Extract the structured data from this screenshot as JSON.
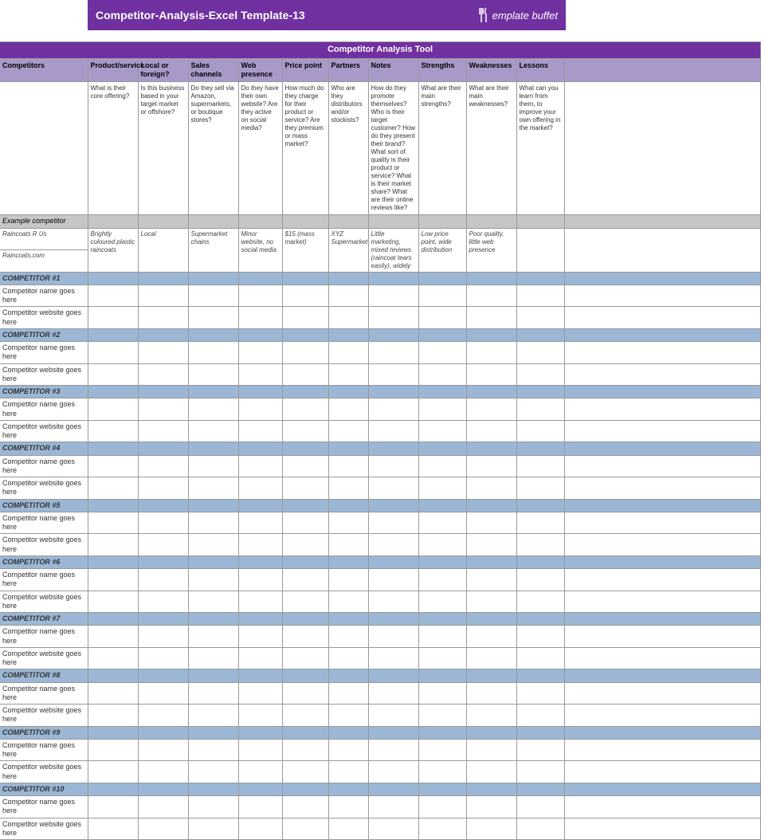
{
  "header": {
    "title": "Competitor-Analysis-Excel Template-13",
    "logo_text": "emplate buffet"
  },
  "table": {
    "title": "Competitor Analysis Tool",
    "columns": [
      "Competitors",
      "Product/service",
      "Local or foreign?",
      "Sales channels",
      "Web presence",
      "Price point",
      "Partners",
      "Notes",
      "Strengths",
      "Weaknesses",
      "Lessons"
    ],
    "desc": [
      "",
      "What is their core offering?",
      "Is this business based in your target market or offshore?",
      "Do they sell via Amazon, supermarkets, or boutique stores?",
      "Do they have their own website? Are they active on social media?",
      "How much do they charge for their product or service? Are they premium or mass market?",
      "Who are they distributors and/or stockists?",
      "How do they promote themselves? Who is their target customer? How do they present their brand? What sort of quality is their product or service? What is their market share? What are their online reviews like?",
      "What are their main strengths?",
      "What are their main weaknesses?",
      "What can you learn from them, to improve your own offering in the market?"
    ],
    "example": {
      "label": "Example competitor",
      "name": "Raincoats R Us",
      "website": "Raincoats.com",
      "data": [
        "Brightly coloured plastic raincoats",
        "Local",
        "Supermarket chains",
        "Minor website, no social media",
        "$15 (mass market)",
        "XYZ Supermarket",
        "Little marketing, mixed reviews (raincoat tears easily), widely",
        "Low price point, wide distribution",
        "Poor quality, little web presence",
        ""
      ]
    },
    "competitors": [
      {
        "head": "COMPETITOR #1",
        "name": "Competitor name goes here",
        "site": "Competitor website goes here"
      },
      {
        "head": "COMPETITOR #2",
        "name": "Competitor name goes here",
        "site": "Competitor website goes here"
      },
      {
        "head": "COMPETITOR #3",
        "name": "Competitor name goes here",
        "site": "Competitor website goes here"
      },
      {
        "head": "COMPETITOR #4",
        "name": "Competitor name goes here",
        "site": "Competitor website goes here"
      },
      {
        "head": "COMPETITOR #5",
        "name": "Competitor name goes here",
        "site": "Competitor website goes here"
      },
      {
        "head": "COMPETITOR #6",
        "name": "Competitor name goes here",
        "site": "Competitor website goes here"
      },
      {
        "head": "COMPETITOR #7",
        "name": "Competitor name goes here",
        "site": "Competitor website goes here"
      },
      {
        "head": "COMPETITOR #8",
        "name": "Competitor name goes here",
        "site": "Competitor website goes here"
      },
      {
        "head": "COMPETITOR #9",
        "name": "Competitor name goes here",
        "site": "Competitor website goes here"
      },
      {
        "head": "COMPETITOR #10",
        "name": "Competitor name goes here",
        "site": "Competitor website goes here"
      }
    ]
  }
}
